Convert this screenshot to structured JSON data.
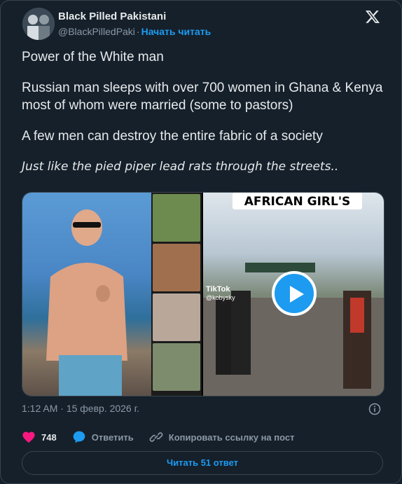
{
  "author": {
    "name": "Black Pilled Pakistani",
    "handle": "@BlackPilledPaki",
    "follow_label": "Начать читать"
  },
  "tweet": {
    "paragraphs": [
      "Power of the White man",
      "Russian man sleeps with over 700 women in Ghana & Kenya most of whom were married (some to pastors)",
      "A few men can destroy the entire fabric of a society"
    ],
    "italic_line": "Just like the pied piper lead rats through the streets.."
  },
  "media": {
    "caption": "AFRICAN GIRL'S",
    "tiktok_label": "TikTok",
    "tiktok_user": "@kobysky"
  },
  "meta": {
    "timestamp": "1:12 AM · 15 февр. 2026 г."
  },
  "actions": {
    "likes": "748",
    "reply_label": "Ответить",
    "copy_label": "Копировать ссылку на пост"
  },
  "read_replies": "Читать 51 ответ",
  "colors": {
    "background": "#15202b",
    "accent": "#1d9bf0",
    "like": "#f91880",
    "muted": "#8b98a5"
  },
  "icons": [
    "x-logo-icon",
    "info-icon",
    "heart-icon",
    "reply-icon",
    "link-icon",
    "play-icon"
  ]
}
